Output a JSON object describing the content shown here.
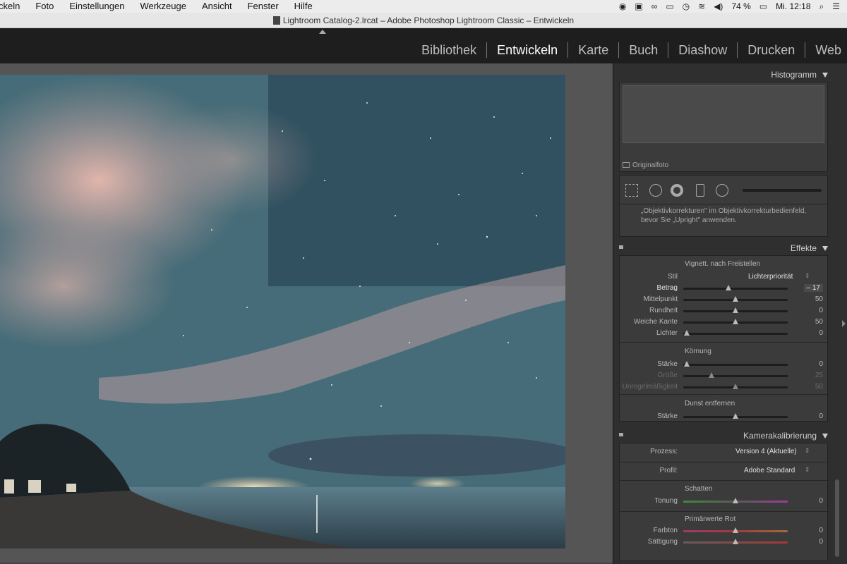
{
  "menubar": {
    "items": [
      "ckeln",
      "Foto",
      "Einstellungen",
      "Werkzeuge",
      "Ansicht",
      "Fenster",
      "Hilfe"
    ],
    "battery": "74 %",
    "clock": "Mi. 12:18"
  },
  "window": {
    "title": "Lightroom Catalog-2.lrcat – Adobe Photoshop Lightroom Classic – Entwickeln"
  },
  "modules": [
    "Bibliothek",
    "Entwickeln",
    "Karte",
    "Buch",
    "Diashow",
    "Drucken",
    "Web"
  ],
  "active_module": "Entwickeln",
  "panels": {
    "histogram": {
      "title": "Histogramm",
      "original_label": "Originalfoto"
    },
    "lens_note": {
      "line1": "„Objektivkorrekturen\" im Objektivkorrekturbedienfeld,",
      "line2": "bevor Sie „Upright\" anwenden."
    },
    "effects": {
      "title": "Effekte",
      "vignette_title": "Vignett. nach Freistellen",
      "style_label": "Stil",
      "style_value": "Lichterpriorität",
      "sliders": [
        {
          "label": "Betrag",
          "value": "– 17"
        },
        {
          "label": "Mittelpunkt",
          "value": "50"
        },
        {
          "label": "Rundheit",
          "value": "0"
        },
        {
          "label": "Weiche Kante",
          "value": "50"
        },
        {
          "label": "Lichter",
          "value": "0"
        }
      ],
      "grain_title": "Körnung",
      "grain_sliders": [
        {
          "label": "Stärke",
          "value": "0"
        },
        {
          "label": "Größe",
          "value": "25"
        },
        {
          "label": "Unregelmäßigkeit",
          "value": "50"
        }
      ],
      "dehaze_title": "Dunst entfernen",
      "dehaze_slider": {
        "label": "Stärke",
        "value": "0"
      }
    },
    "calibration": {
      "title": "Kamerakalibrierung",
      "process_label": "Prozess:",
      "process_value": "Version 4 (Aktuelle)",
      "profile_label": "Profil:",
      "profile_value": "Adobe Standard",
      "shadows_title": "Schatten",
      "tint": {
        "label": "Tonung",
        "value": "0"
      },
      "red_title": "Primärwerte Rot",
      "hue": {
        "label": "Farbton",
        "value": "0"
      },
      "saturation": {
        "label": "Sättigung",
        "value": "0"
      }
    }
  }
}
